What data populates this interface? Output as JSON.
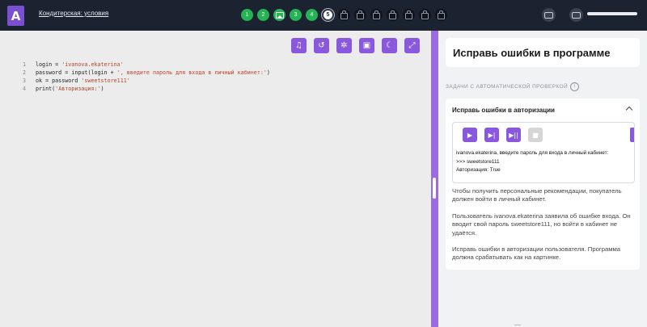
{
  "header": {
    "logo_letter": "A",
    "course_title": "Кондитерская: условия",
    "steps": [
      {
        "label": "1",
        "state": "done"
      },
      {
        "label": "2",
        "state": "done"
      },
      {
        "label": "",
        "state": "done-image"
      },
      {
        "label": "3",
        "state": "done"
      },
      {
        "label": "4",
        "state": "done"
      },
      {
        "label": "5",
        "state": "current"
      },
      {
        "label": "",
        "state": "locked"
      },
      {
        "label": "",
        "state": "locked"
      },
      {
        "label": "",
        "state": "locked"
      },
      {
        "label": "",
        "state": "locked"
      },
      {
        "label": "",
        "state": "locked"
      },
      {
        "label": "",
        "state": "locked"
      },
      {
        "label": "",
        "state": "locked"
      }
    ],
    "chat_icons": [
      "chat-icon",
      "chat-icon"
    ]
  },
  "editor": {
    "toolbar_icons": [
      "notes-icon",
      "undo-icon",
      "bug-icon",
      "save-icon",
      "theme-moon-icon",
      "fullscreen-icon"
    ],
    "lines": [
      {
        "num": "1",
        "parts": [
          {
            "t": "login = ",
            "c": "src"
          },
          {
            "t": "'ivanova.ekaterina'",
            "c": "str"
          }
        ]
      },
      {
        "num": "2",
        "parts": [
          {
            "t": "password = ",
            "c": "src"
          },
          {
            "t": "input",
            "c": "fn"
          },
          {
            "t": "(login + ",
            "c": "src"
          },
          {
            "t": "', введите пароль для входа в личный кабинет:'",
            "c": "str"
          },
          {
            "t": ")",
            "c": "src"
          }
        ]
      },
      {
        "num": "3",
        "parts": [
          {
            "t": "ok = password ",
            "c": "src"
          },
          {
            "t": "'sweetstore111'",
            "c": "str"
          }
        ]
      },
      {
        "num": "4",
        "parts": [
          {
            "t": "print",
            "c": "fn"
          },
          {
            "t": "(",
            "c": "src"
          },
          {
            "t": "'Авторизация:'",
            "c": "str"
          },
          {
            "t": ")",
            "c": "src"
          }
        ]
      }
    ]
  },
  "panel": {
    "title": "Исправь ошибки в программе",
    "section_label": "ЗАДАЧИ С АВТОМАТИЧЕСКОЙ ПРОВЕРКОЙ",
    "exercise": {
      "header": "Исправь ошибки в авторизации",
      "output": [
        "ivanova.ekaterina, введите пароль для входа в личный кабинет:",
        ">>> sweetstore111",
        "Авторизация: True"
      ],
      "paragraphs": [
        "Чтобы получить персональные рекомендации, покупатель должен войти в личный кабинет.",
        "Пользователь ivanova.ekaterina заявила об ошибке входа. Он вводит свой пароль sweetstore111, но войти в кабинет не удаётся.",
        "Исправь ошибки в авторизации пользователя. Программа должна срабатывать как на картинке."
      ]
    }
  }
}
